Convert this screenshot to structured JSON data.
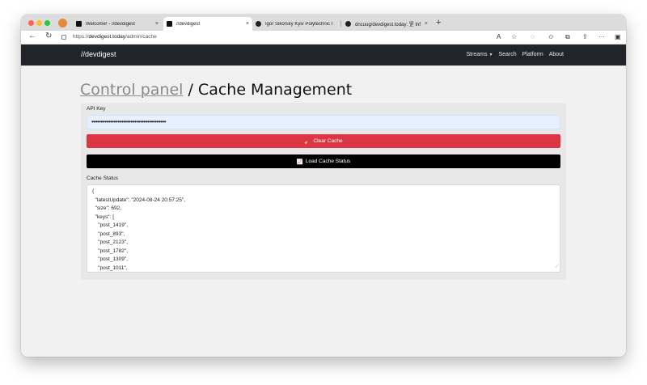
{
  "browser": {
    "tabs": [
      {
        "title": "Welcome! - //devdigest",
        "active": false
      },
      {
        "title": "//devdigest",
        "active": true
      },
      {
        "title": "Igor Sikorsky Kyiv Polytechnic I",
        "active": false
      },
      {
        "title": "dncuug/devdigest.today: 罡 Inf",
        "active": false
      }
    ],
    "tab_close": "×",
    "new_tab": "+",
    "url_prefix": "https://",
    "url_host": "devdigest.today",
    "url_path": "/admin/cache",
    "icons": [
      "read-aloud-icon",
      "favorite-icon",
      "extensions-icon",
      "favorites-bar-icon",
      "collections-icon",
      "share-icon",
      "more-icon",
      "sidebar-icon"
    ]
  },
  "site": {
    "brand": "//devdigest",
    "nav": [
      {
        "label": "Streams",
        "dropdown": true
      },
      {
        "label": "Search"
      },
      {
        "label": "Platform"
      },
      {
        "label": "About"
      }
    ]
  },
  "page": {
    "breadcrumb_link": "Control panel",
    "separator": " / ",
    "title": "Cache Management",
    "api_key_label": "API Key",
    "api_key_value": "••••••••••••••••••••••••••••••••••••••••",
    "clear_cache_label": "Clear Cache",
    "load_status_label": "Load Cache Status",
    "cache_status_label": "Cache Status",
    "cache_status_text": "{\n  \"latestUpdate\": \"2024-08-24 20:57:25\",\n  \"size\": 692,\n  \"keys\": [\n    \"post_1419\",\n    \"post_893\",\n    \"post_2123\",\n    \"post_1782\",\n    \"post_1309\",\n    \"post_1011\",\n    \"post_..."
  },
  "colors": {
    "navbar": "#212529",
    "danger": "#dc3545",
    "dark_button": "#000000",
    "input_bg": "#e6f0fe"
  }
}
